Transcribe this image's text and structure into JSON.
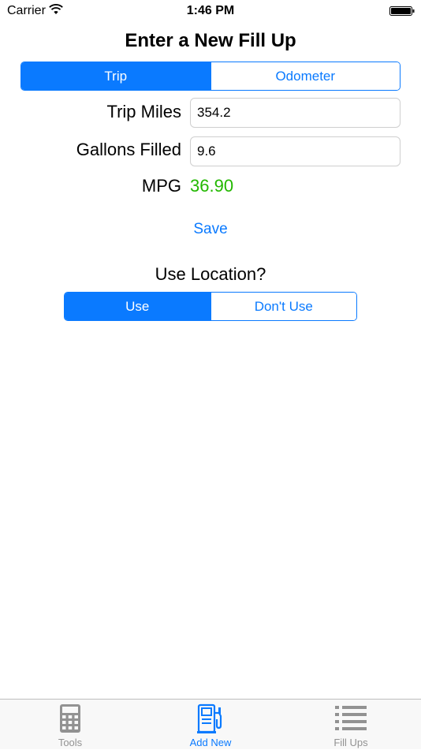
{
  "status_bar": {
    "carrier": "Carrier",
    "time": "1:46 PM"
  },
  "page_title": "Enter a New Fill Up",
  "mode_segment": {
    "options": [
      "Trip",
      "Odometer"
    ],
    "selected": "Trip"
  },
  "form": {
    "trip_miles_label": "Trip Miles",
    "trip_miles_value": "354.2",
    "gallons_label": "Gallons Filled",
    "gallons_value": "9.6",
    "mpg_label": "MPG",
    "mpg_value": "36.90"
  },
  "save_label": "Save",
  "location": {
    "title": "Use Location?",
    "options": [
      "Use",
      "Don't Use"
    ],
    "selected": "Use"
  },
  "tab_bar": {
    "items": [
      {
        "label": "Tools",
        "icon": "calculator-icon"
      },
      {
        "label": "Add New",
        "icon": "gas-pump-icon",
        "active": true
      },
      {
        "label": "Fill Ups",
        "icon": "list-icon"
      }
    ]
  },
  "colors": {
    "accent": "#0a7aff",
    "mpg_green": "#22b800",
    "tab_inactive": "#929292"
  }
}
